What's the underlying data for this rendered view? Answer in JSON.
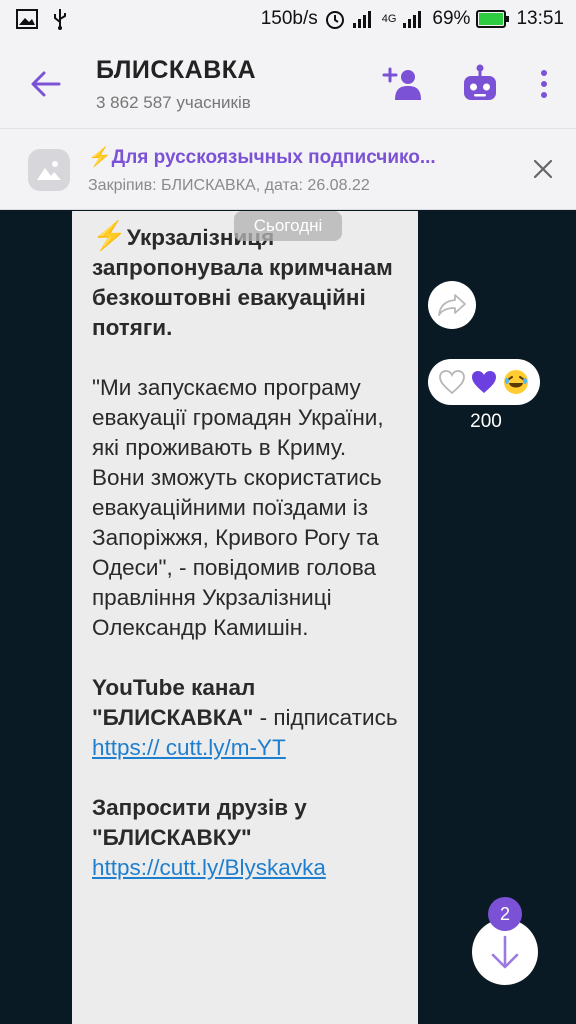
{
  "status_bar": {
    "speed": "150b/s",
    "network": "4G",
    "battery": "69%",
    "time": "13:51",
    "battery_color": "#2ecc40"
  },
  "header": {
    "title": "БЛИСКАВКА",
    "subtitle": "3 862 587 учасників",
    "accent": "#7b52d6"
  },
  "pinned": {
    "title": "⚡Для русскоязычных подписчико...",
    "meta": "Закріпив: БЛИСКАВКА, дата: 26.08.22"
  },
  "chat": {
    "date_chip": "Сьогодні",
    "message": {
      "bolt": "⚡",
      "headline": "Укрзалізниця запропонувала кримчанам безкоштовні евакуаційні потяги.",
      "quote": "\"Ми запускаємо програму евакуації громадян України, які проживають в Криму. Вони зможуть скористатись евакуаційними поїздами із Запоріжжя, Кривого Рогу та Одеси\", - повідомив голова правління Укрзалізниці Олександр Камишін.",
      "youtube_bold": "YouTube канал \"БЛИСКАВКА\"",
      "youtube_text": " - підписатись ",
      "youtube_link": "https:// cutt.ly/m-YT",
      "invite_bold": "Запросити друзів у \"БЛИСКАВКУ\"",
      "invite_link": "https://cutt.ly/Blyskavka"
    },
    "reactions": {
      "count": "200",
      "emojis": [
        "heart-outline-icon",
        "purple-heart-icon",
        "laughing-emoji-icon"
      ]
    },
    "unread_count": "2"
  }
}
